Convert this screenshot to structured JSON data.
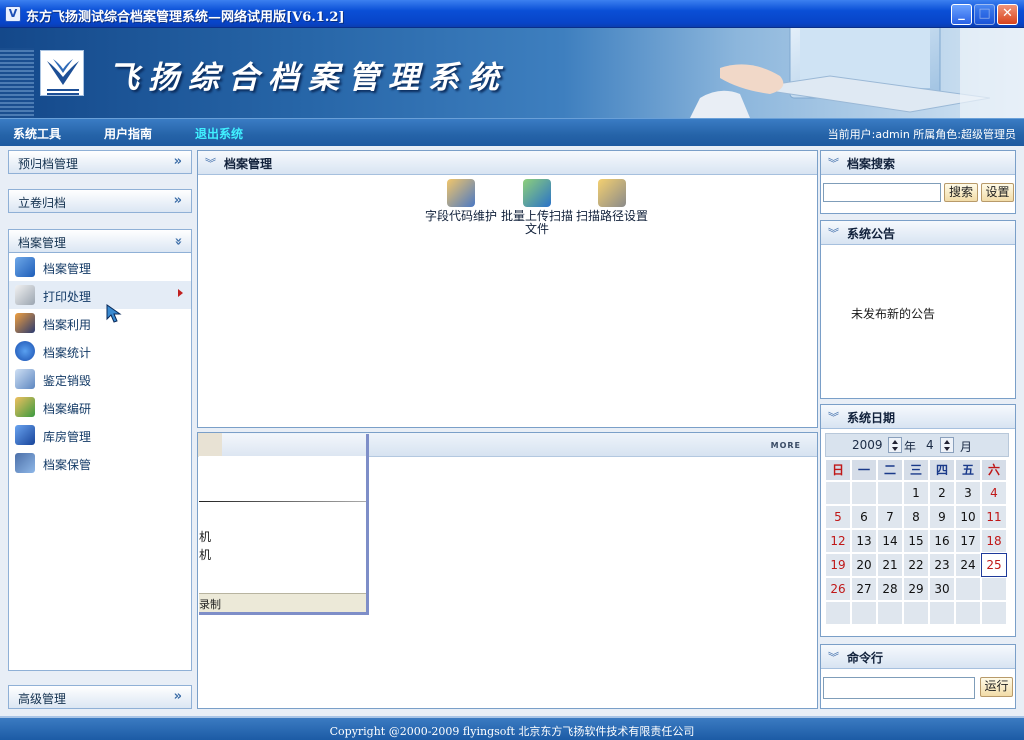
{
  "window": {
    "title": "东方飞扬测试综合档案管理系统—网络试用版[V6.1.2]",
    "banner_title": "飞扬综合档案管理系统",
    "icons": [
      "app-icon",
      "minimize-icon",
      "maximize-icon",
      "close-icon"
    ]
  },
  "menu": {
    "items": [
      {
        "label": "系统工具"
      },
      {
        "label": "用户指南"
      },
      {
        "label": "退出系统"
      }
    ],
    "user_info": "当前用户:admin  所属角色:超级管理员"
  },
  "sidebar": {
    "sections": [
      {
        "label": "预归档管理"
      },
      {
        "label": "立卷归档"
      },
      {
        "label": "档案管理"
      }
    ],
    "items": [
      {
        "label": "档案管理",
        "icon": "archive-icon"
      },
      {
        "label": "打印处理",
        "icon": "printer-icon"
      },
      {
        "label": "档案利用",
        "icon": "archive-use-icon"
      },
      {
        "label": "档案统计",
        "icon": "info-icon"
      },
      {
        "label": "鉴定销毁",
        "icon": "appraise-icon"
      },
      {
        "label": "档案编研",
        "icon": "users-icon"
      },
      {
        "label": "库房管理",
        "icon": "storage-icon"
      },
      {
        "label": "档案保管",
        "icon": "custody-icon"
      }
    ],
    "bottom_section": "高级管理"
  },
  "main": {
    "title": "档案管理",
    "icons": [
      {
        "label": "字段代码维护",
        "icon": "field-code-icon"
      },
      {
        "label": "批量上传扫描文件",
        "icon": "batch-upload-icon"
      },
      {
        "label": "扫描路径设置",
        "icon": "scan-path-icon"
      }
    ],
    "more_label": "MORE",
    "popup": {
      "row1": "机",
      "row2": "机",
      "status": "录制"
    }
  },
  "right": {
    "search": {
      "title": "档案搜索",
      "value": "",
      "search_button": "搜索",
      "settings_button": "设置"
    },
    "notice": {
      "title": "系统公告",
      "text": "未发布新的公告"
    },
    "calendar": {
      "title": "系统日期",
      "year": "2009",
      "year_label": "年",
      "month": "4",
      "month_label": "月",
      "weekdays": [
        "日",
        "一",
        "二",
        "三",
        "四",
        "五",
        "六"
      ],
      "weeks": [
        [
          "",
          "",
          "",
          "1",
          "2",
          "3",
          "4"
        ],
        [
          "5",
          "6",
          "7",
          "8",
          "9",
          "10",
          "11"
        ],
        [
          "12",
          "13",
          "14",
          "15",
          "16",
          "17",
          "18"
        ],
        [
          "19",
          "20",
          "21",
          "22",
          "23",
          "24",
          "25"
        ],
        [
          "26",
          "27",
          "28",
          "29",
          "30",
          "",
          ""
        ],
        [
          "",
          "",
          "",
          "",
          "",
          "",
          ""
        ]
      ],
      "today": "25"
    },
    "command": {
      "title": "命令行",
      "value": "",
      "run_button": "运行"
    }
  },
  "footer": {
    "text": "Copyright @2000-2009 flyingsoft 北京东方飞扬软件技术有限责任公司"
  },
  "colors": {
    "accent": "#2563a8",
    "active_menu": "#40f0ff",
    "weekend_red": "#c01818"
  }
}
